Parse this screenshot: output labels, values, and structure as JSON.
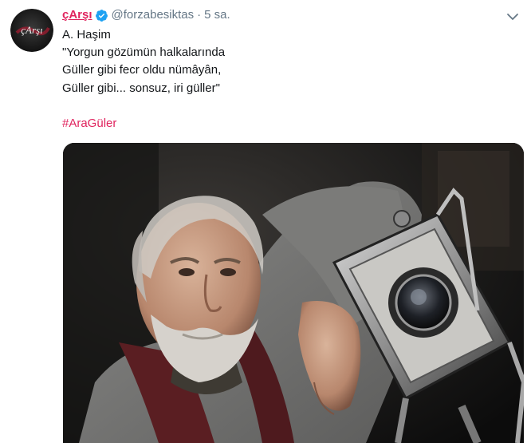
{
  "tweet": {
    "display_name": "çArşı",
    "handle": "@forzabesiktas",
    "separator": "·",
    "timestamp": "5 sa.",
    "avatar_text": "çArşı",
    "text_lines": [
      "A. Haşim",
      "\"Yorgun gözümün halkalarında",
      "Güller gibi fecr oldu nümâyân,",
      "Güller gibi... sonsuz, iri güller\""
    ],
    "hashtag": "#AraGüler",
    "icons": {
      "verified": "verified-badge-icon",
      "caret": "chevron-down-icon"
    },
    "colors": {
      "brand": "#e0245e",
      "verified": "#1da1f2",
      "muted": "#657786",
      "text": "#14171a"
    }
  }
}
